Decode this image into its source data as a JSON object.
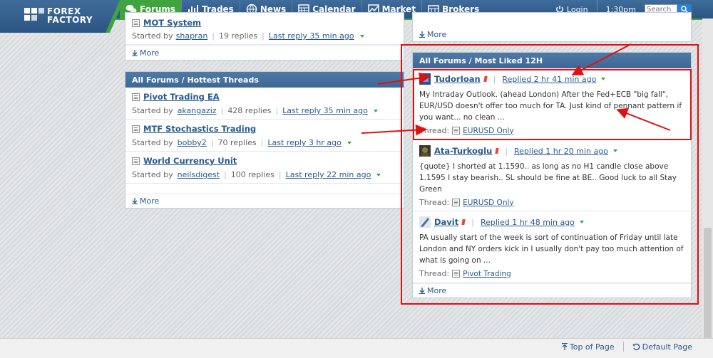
{
  "brand": {
    "line1": "FOREX",
    "line2": "FACTORY"
  },
  "nav": {
    "items": [
      {
        "label": "Forums",
        "icon": "forums-icon"
      },
      {
        "label": "Trades",
        "icon": "trades-icon"
      },
      {
        "label": "News",
        "icon": "news-icon"
      },
      {
        "label": "Calendar",
        "icon": "calendar-icon"
      },
      {
        "label": "Market",
        "icon": "market-icon"
      },
      {
        "label": "Brokers",
        "icon": "brokers-icon"
      }
    ],
    "login": "Login",
    "time": "1:30pm",
    "search_placeholder": "Search"
  },
  "top_left_panel": {
    "title": "MOT System",
    "started_by_label": "Started by",
    "author": "shapran",
    "replies": "19 replies",
    "last_reply": "Last reply 35 min ago",
    "more": "More"
  },
  "top_right_panel": {
    "more": "More"
  },
  "hottest": {
    "header": "All Forums / Hottest Threads",
    "threads": [
      {
        "title": "Pivot Trading EA",
        "started_by": "Started by",
        "author": "akangaziz",
        "replies": "428 replies",
        "last_reply": "Last reply 35 min ago"
      },
      {
        "title": "MTF Stochastics Trading",
        "started_by": "Started by",
        "author": "bobby2",
        "replies": "70 replies",
        "last_reply": "Last reply 3 hr ago"
      },
      {
        "title": "World Currency Unit",
        "started_by": "Started by",
        "author": "neilsdigest",
        "replies": "100 replies",
        "last_reply": "Last reply 22 min ago"
      }
    ],
    "more": "More"
  },
  "most_liked": {
    "header": "All Forums / Most Liked 12H",
    "thread_label": "Thread:",
    "posts": [
      {
        "user": "TudorIoan",
        "replied": "Replied 2 hr 41 min ago",
        "body": "My Intraday Outlook. (ahead London) After the Fed+ECB \"big fall\", EUR/USD doesn't offer too much for TA. Just kind of pennant pattern if you want... no clean ...",
        "thread": "EURUSD Only"
      },
      {
        "user": "Ata-Turkoglu",
        "replied": "Replied 1 hr 20 min ago",
        "body": "{quote} I shorted at 1.1590.. as long as no H1 candle close above 1.1595 I stay bearish.. SL should be fine at BE.. Good luck to all Stay Green",
        "thread": "EURUSD Only"
      },
      {
        "user": "Davit",
        "replied": "Replied 1 hr 48 min ago",
        "body": "PA usually start of the week is sort of continuation of Friday until late London and NY orders kick in I usually don't pay too much attention of what is going on ...",
        "thread": "Pivot Trading"
      }
    ],
    "more": "More"
  },
  "footer": {
    "top_of_page": "Top of Page",
    "default_page": "Default Page"
  },
  "colors": {
    "header_blue": "#2c5583",
    "accent_green": "#3fa33f",
    "annotation_red": "#e01010",
    "link": "#2a5a8c"
  }
}
